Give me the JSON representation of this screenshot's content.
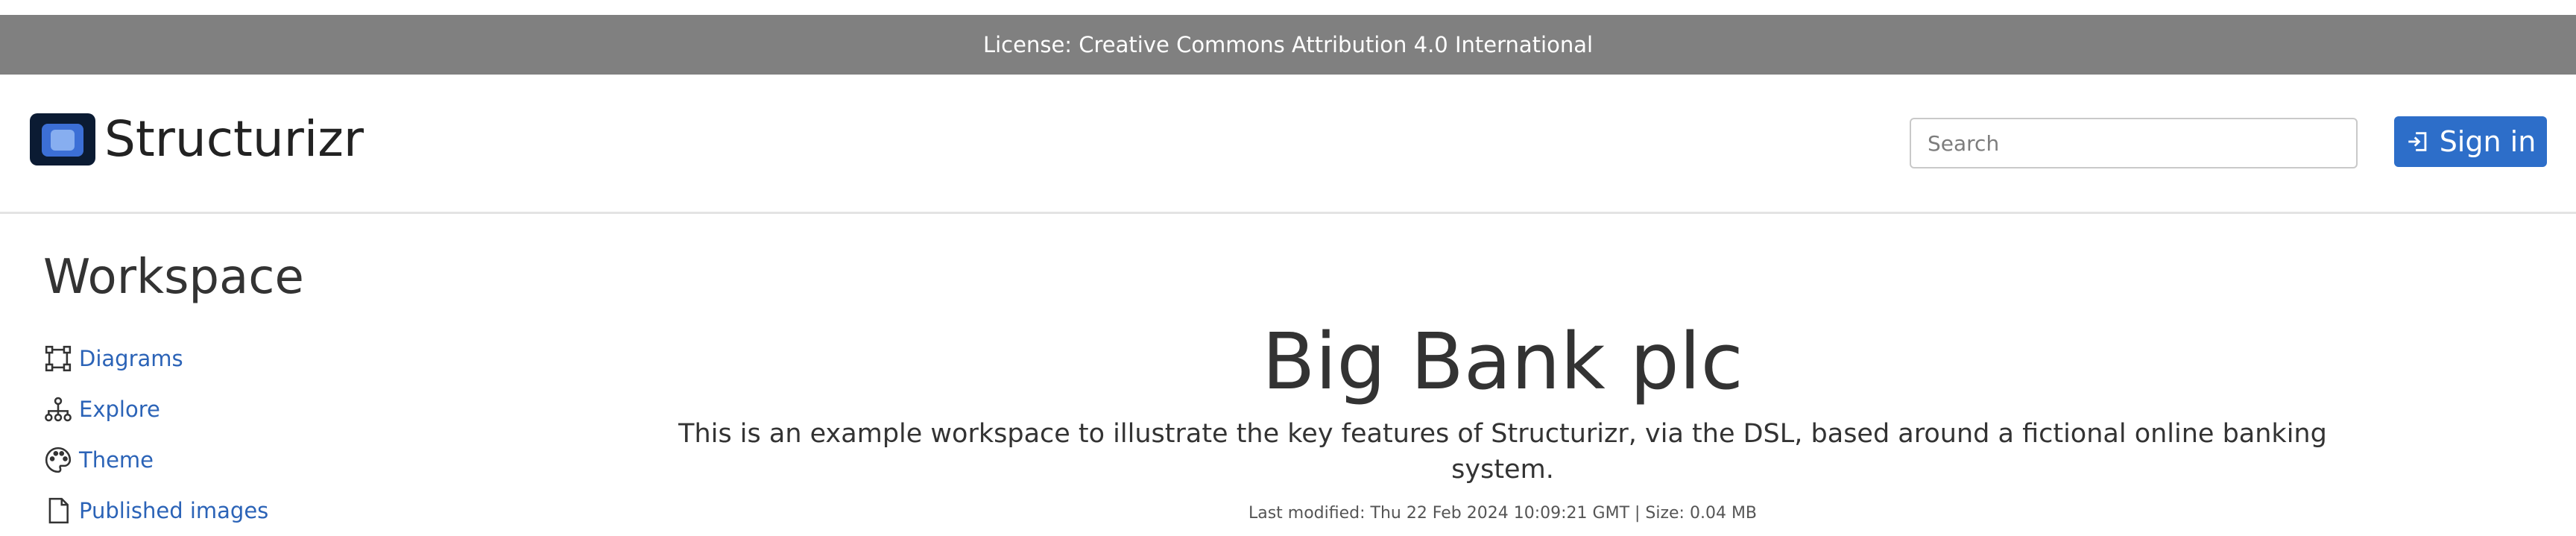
{
  "banner": {
    "license_text": "License: Creative Commons Attribution 4.0 International"
  },
  "header": {
    "brand_name": "Structurizr",
    "search_placeholder": "Search",
    "signin_label": "Sign in"
  },
  "sidebar": {
    "title": "Workspace",
    "items": [
      {
        "label": "Diagrams",
        "icon": "diagram-icon"
      },
      {
        "label": "Explore",
        "icon": "hierarchy-icon"
      },
      {
        "label": "Theme",
        "icon": "palette-icon"
      },
      {
        "label": "Published images",
        "icon": "image-file-icon"
      }
    ]
  },
  "main": {
    "title": "Big Bank plc",
    "description": "This is an example workspace to illustrate the key features of Structurizr, via the DSL, based around a fictional online banking system.",
    "meta": "Last modified: Thu 22 Feb 2024 10:09:21 GMT | Size: 0.04 MB"
  },
  "colors": {
    "banner_bg": "#808080",
    "accent": "#2d6ec9",
    "link": "#2b63b7"
  }
}
